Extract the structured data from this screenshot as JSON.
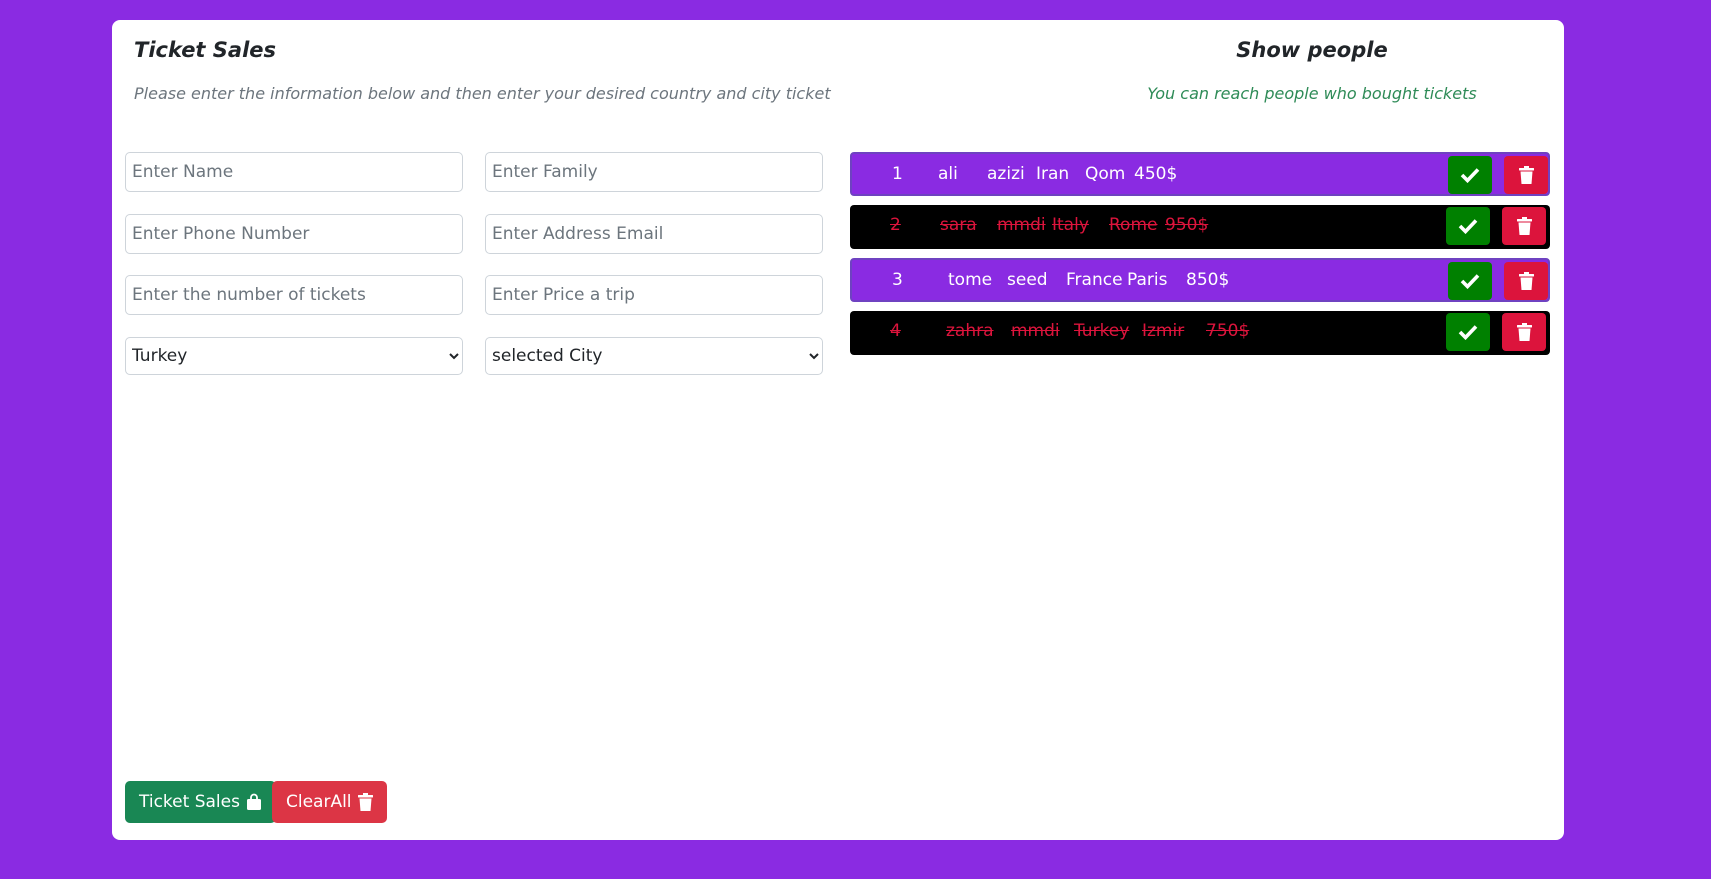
{
  "form": {
    "title": "Ticket Sales",
    "subtitle": "Please enter the information below and then enter your desired country and city ticket",
    "name_placeholder": "Enter Name",
    "family_placeholder": "Enter Family",
    "phone_placeholder": "Enter Phone Number",
    "email_placeholder": "Enter Address Email",
    "tickets_placeholder": "Enter the number of tickets",
    "price_placeholder": "Enter Price a trip",
    "country_selected": "Turkey",
    "city_selected": "selected City",
    "sales_button": "Ticket Sales",
    "clear_button": "ClearAll"
  },
  "people": {
    "title": "Show people",
    "subtitle": "You can reach people who bought tickets",
    "rows": [
      {
        "id": "1",
        "name": "ali",
        "family": "azizi",
        "country": "Iran",
        "city": "Qom",
        "price": "450$",
        "done": false
      },
      {
        "id": "2",
        "name": "sara",
        "family": "mmdi",
        "country": "Italy",
        "city": "Rome",
        "price": "950$",
        "done": true
      },
      {
        "id": "3",
        "name": "tome",
        "family": "seed",
        "country": "France",
        "city": "Paris",
        "price": "850$",
        "done": false
      },
      {
        "id": "4",
        "name": "zahra",
        "family": "mmdi",
        "country": "Turkey",
        "city": "Izmir",
        "price": "750$",
        "done": true
      }
    ]
  },
  "colors": {
    "background": "#8a2be2",
    "active_row": "#8a2be2",
    "done_row": "#000000",
    "done_text": "#dc143c",
    "check_button": "#008000",
    "delete_button": "#dc143c",
    "sales_button": "#198754",
    "clear_button": "#dc3545"
  },
  "icons": {
    "row_check": "check-icon",
    "row_delete": "trash-icon",
    "sales_button": "shopping-bag-icon",
    "clear_button": "trash-icon"
  }
}
